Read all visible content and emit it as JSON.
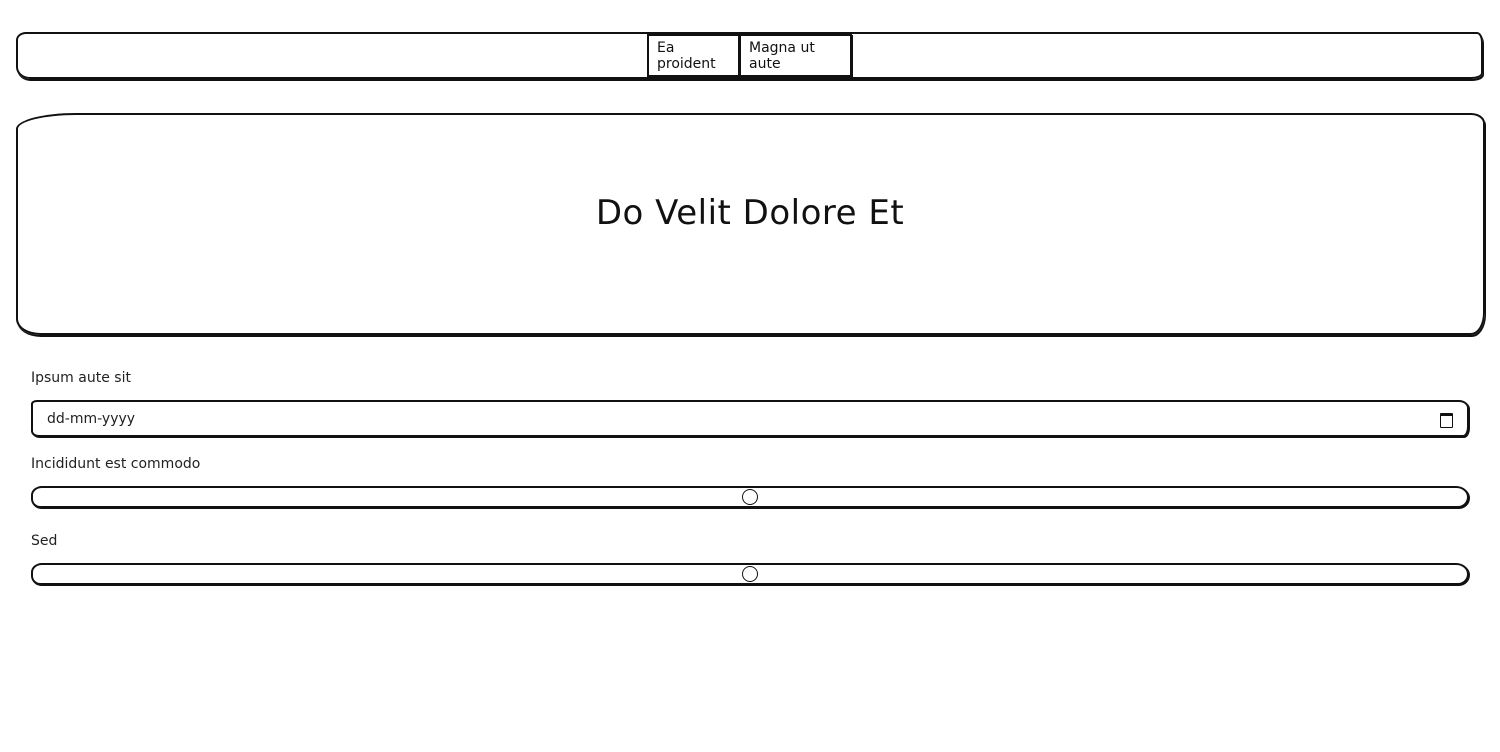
{
  "nav": {
    "buttons": [
      "Ea proident",
      "Magna ut aute"
    ]
  },
  "hero": {
    "title": "Do Velit Dolore Et"
  },
  "form": {
    "date_field": {
      "label": "Ipsum aute sit",
      "placeholder": "dd-mm-yyyy",
      "icon": "calendar-icon"
    },
    "range1": {
      "label": "Incididunt est commodo",
      "value_fraction": 0.5
    },
    "range2": {
      "label": "Sed",
      "value_fraction": 0.5
    }
  }
}
